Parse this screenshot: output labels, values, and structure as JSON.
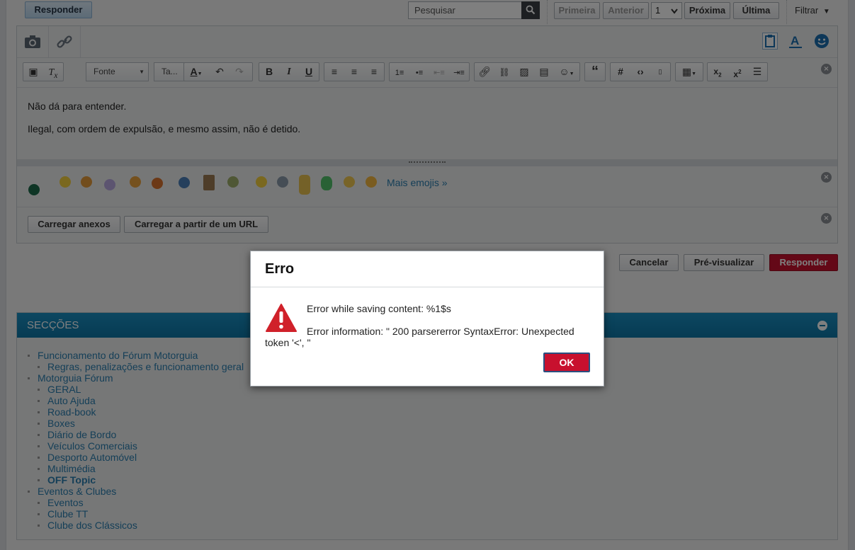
{
  "topbar": {
    "reply_label": "Responder",
    "search_placeholder": "Pesquisar",
    "first_label": "Primeira",
    "prev_label": "Anterior",
    "page_value": "1",
    "next_label": "Próxima",
    "last_label": "Última",
    "filter_label": "Filtrar"
  },
  "toolbar": {
    "font_label": "Fonte",
    "size_label": "Ta..."
  },
  "editor": {
    "line1": "Não dá para entender.",
    "line2": "Ilegal, com ordem de expulsão, e mesmo assim, não é detido."
  },
  "emojis": {
    "more_label": "Mais emojis »"
  },
  "attachments": {
    "upload_label": "Carregar anexos",
    "url_label": "Carregar a partir de um URL"
  },
  "actions": {
    "cancel_label": "Cancelar",
    "preview_label": "Pré-visualizar",
    "reply_label": "Responder"
  },
  "sections": {
    "title": "SECÇÕES",
    "items": [
      {
        "label": "Funcionamento do Fórum Motorguia",
        "level": 1
      },
      {
        "label": "Regras, penalizações e funcionamento geral",
        "level": 2
      },
      {
        "label": "Motorguia Fórum",
        "level": 1
      },
      {
        "label": "GERAL",
        "level": 2
      },
      {
        "label": "Auto Ajuda",
        "level": 2
      },
      {
        "label": "Road-book",
        "level": 2
      },
      {
        "label": "Boxes",
        "level": 2
      },
      {
        "label": "Diário de Bordo",
        "level": 2
      },
      {
        "label": "Veículos Comerciais",
        "level": 2
      },
      {
        "label": "Desporto Automóvel",
        "level": 2
      },
      {
        "label": "Multimédia",
        "level": 2
      },
      {
        "label": "OFF Topic",
        "level": 2,
        "bold": true
      },
      {
        "label": "Eventos & Clubes",
        "level": 1
      },
      {
        "label": "Eventos",
        "level": 2
      },
      {
        "label": "Clube TT",
        "level": 2
      },
      {
        "label": "Clube dos Clássicos",
        "level": 2
      }
    ]
  },
  "dialog": {
    "title": "Erro",
    "message1": "Error while saving content: %1$s",
    "message2": "Error information: \" 200 parsererror SyntaxError: Unexpected token '<', \"",
    "ok_label": "OK"
  },
  "colors": {
    "accent": "#1a8fc2",
    "danger": "#c8102e",
    "link": "#2b7fb0"
  }
}
